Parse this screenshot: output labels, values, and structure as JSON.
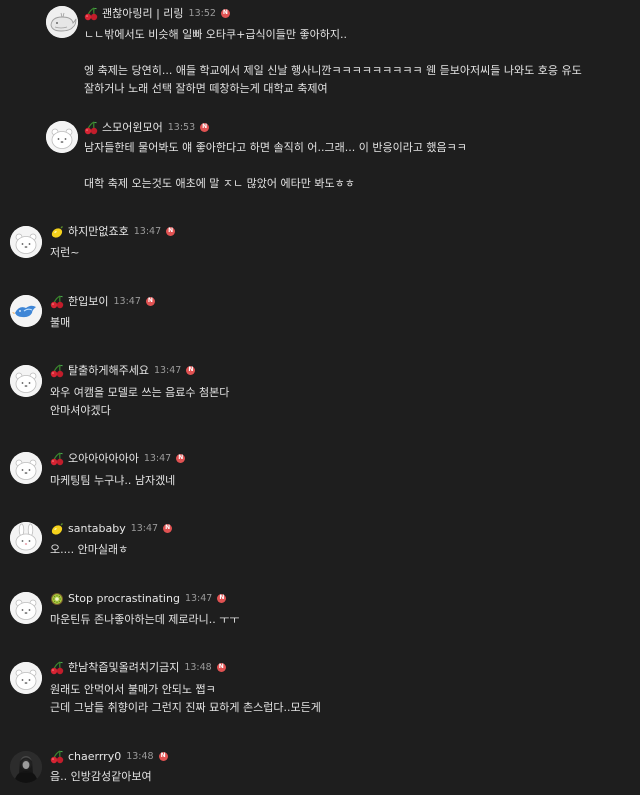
{
  "comments": [
    {
      "nick": "괜찮아링리 | 리링",
      "badge": "cherry",
      "time": "13:52",
      "new_mark": "N",
      "avatar": "whale",
      "lines": [
        "ㄴㄴ밖에서도 비슷해 일빠 오타쿠+급식이들만 좋아하지..",
        "",
        "엥 축제는 당연히... 애들 학교에서 제일 신날 행사니깐ㅋㅋㅋㅋㅋㅋㅋㅋㅋ 웬 듣보아저씨들 나와도 호응 유도",
        "잘하거나 노래 선택 잘하면 떼창하는게 대학교 축제여"
      ]
    },
    {
      "nick": "스모어윈모어",
      "badge": "cherry",
      "time": "13:53",
      "new_mark": "N",
      "avatar": "bear",
      "lines": [
        "남자들한테 물어봐도 얘 좋아한다고 하면 솔직히 어..그래... 이 반응이라고 했음ㅋㅋ",
        "",
        "대학 축제 오는것도 애초에 말 ㅈㄴ 많았어 에타만 봐도ㅎㅎ"
      ]
    },
    {
      "nick": "하지만없죠호",
      "badge": "lemon",
      "time": "13:47",
      "new_mark": "N",
      "avatar": "bear",
      "lines": [
        "저런~"
      ]
    },
    {
      "nick": "한입보이",
      "badge": "cherry",
      "time": "13:47",
      "new_mark": "N",
      "avatar": "bird",
      "lines": [
        "불매"
      ]
    },
    {
      "nick": "탈출하게해주세요",
      "badge": "cherry",
      "time": "13:47",
      "new_mark": "N",
      "avatar": "bear",
      "lines": [
        "와우 여캠을 모델로 쓰는 음료수 첨본다",
        "안마셔야겠다"
      ]
    },
    {
      "nick": "오아아아아아아",
      "badge": "cherry",
      "time": "13:47",
      "new_mark": "N",
      "avatar": "bear",
      "lines": [
        "마케팅팀 누구냐.. 남자겠네"
      ]
    },
    {
      "nick": "santababy",
      "badge": "lemon",
      "time": "13:47",
      "new_mark": "N",
      "avatar": "rabbit",
      "lines": [
        "오.... 안마실래ㅎ"
      ]
    },
    {
      "nick": "Stop procrastinating",
      "badge": "kiwi",
      "time": "13:47",
      "new_mark": "N",
      "avatar": "bear",
      "lines": [
        "마운틴듀 존나좋아하는데 제로라니.. ㅜㅜ"
      ]
    },
    {
      "nick": "한남착즙및올려치기금지",
      "badge": "cherry",
      "time": "13:48",
      "new_mark": "N",
      "avatar": "bear",
      "lines": [
        "원래도 안먹어서 불매가 안되노 쩝ㅋ",
        "근데 그남들 취향이라 그런지 진짜 묘하게 촌스럽다..모든게"
      ]
    },
    {
      "nick": "chaerrry0",
      "badge": "cherry",
      "time": "13:48",
      "new_mark": "N",
      "avatar": "photo",
      "lines": [
        "음.. 인방감성같아보여"
      ]
    }
  ]
}
